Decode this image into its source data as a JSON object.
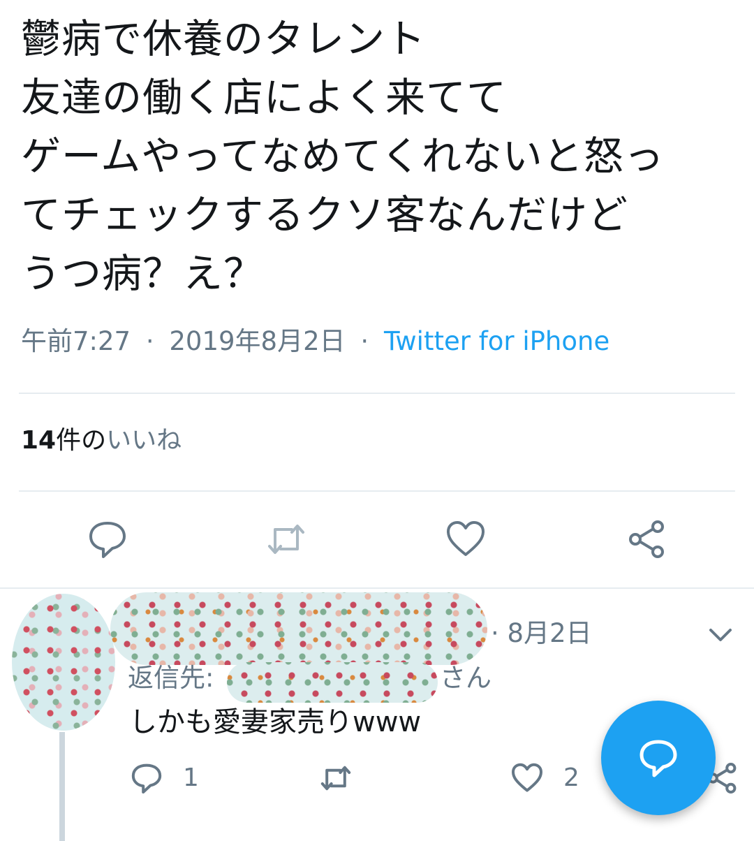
{
  "tweet": {
    "text": "鬱病で休養のタレント\n友達の働く店によく来てて\nゲームやってなめてくれないと怒っ\nてチェックするクソ客なんだけど\nうつ病？え？",
    "time": "午前7:27",
    "date": "2019年8月2日",
    "separator": "·",
    "source": "Twitter for iPhone",
    "likes_count": "14",
    "likes_unit": "件の",
    "likes_label": "いいね"
  },
  "actions": {
    "reply_icon": "reply-icon",
    "retweet_icon": "retweet-icon",
    "like_icon": "heart-icon",
    "share_icon": "share-icon"
  },
  "reply": {
    "date": "· 8月2日",
    "reply_prefix": "返信先:",
    "reply_suffix": "さん",
    "text": "しかも愛妻家売りwww",
    "reply_count": "1",
    "like_count": "2"
  },
  "colors": {
    "accent": "#1da1f2",
    "secondary_text": "#657786",
    "primary_text": "#14171a",
    "divider": "#e6ecf0"
  }
}
